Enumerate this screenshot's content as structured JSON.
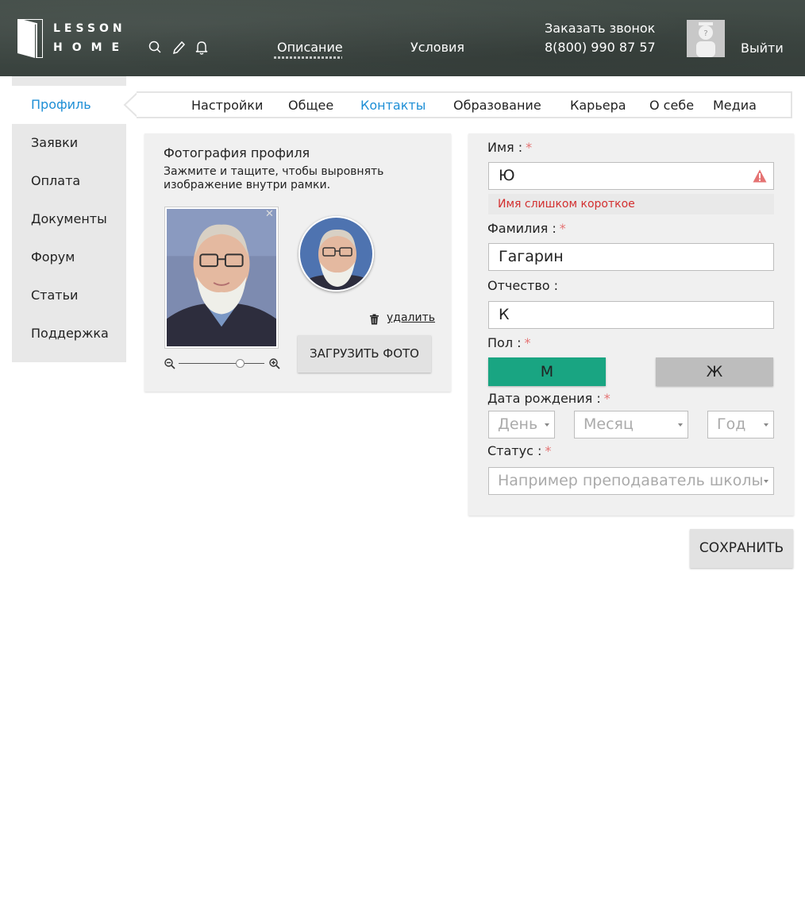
{
  "header": {
    "logo_line1": "LESSON",
    "logo_line2": "HOME",
    "nav": [
      "Описание",
      "Условия"
    ],
    "call_label": "Заказать звонок",
    "call_phone": "8(800) 990 87 57",
    "logout": "Выйти",
    "icons": [
      "search-icon",
      "pencil-icon",
      "bell-icon"
    ]
  },
  "sidebar": {
    "items": [
      {
        "label": "Профиль",
        "active": true
      },
      {
        "label": "Заявки"
      },
      {
        "label": "Оплата"
      },
      {
        "label": "Документы"
      },
      {
        "label": "Форум"
      },
      {
        "label": "Статьи"
      },
      {
        "label": "Поддержка"
      }
    ]
  },
  "tabs": [
    {
      "label": "Настройки"
    },
    {
      "label": "Общее"
    },
    {
      "label": "Контакты",
      "active": true
    },
    {
      "label": "Образование"
    },
    {
      "label": "Карьера"
    },
    {
      "label": "О себе"
    },
    {
      "label": "Медиа"
    }
  ],
  "photo": {
    "title": "Фотография профиля",
    "hint": "Зажмите и тащите, чтобы выровнять изображение внутри рамки.",
    "delete": "удалить",
    "upload": "ЗАГРУЗИТЬ ФОТО",
    "zoom_level": 0.72
  },
  "form": {
    "first_name_label": "Имя :",
    "first_name_value": "Ю",
    "first_name_error": "Имя слишком короткое",
    "last_name_label": "Фамилия :",
    "last_name_value": "Гагарин",
    "patronymic_label": "Отчество :",
    "patronymic_value": "К",
    "gender_label": "Пол :",
    "gender_m": "М",
    "gender_f": "Ж",
    "gender_selected": "М",
    "birth_label": "Дата рождения :",
    "day_placeholder": "День",
    "month_placeholder": "Месяц",
    "year_placeholder": "Год",
    "status_label": "Статус :",
    "status_placeholder": "Например преподаватель школы",
    "required_mark": "*"
  },
  "save": "СОХРАНИТЬ",
  "colors": {
    "accent": "#1e8fd6",
    "selected_gender": "#19a582",
    "error": "#d32f2f",
    "required": "#e57373"
  }
}
